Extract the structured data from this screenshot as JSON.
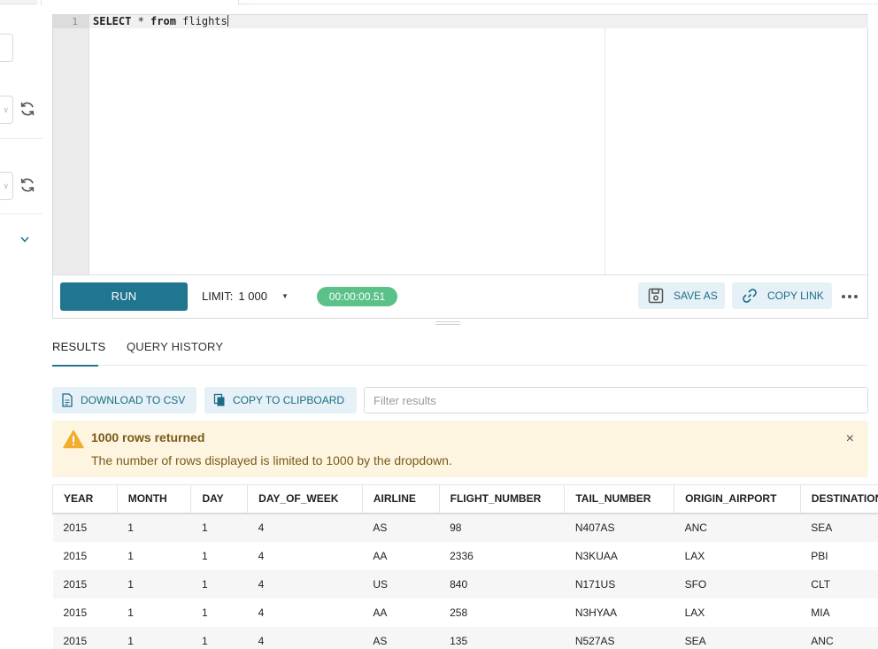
{
  "editor": {
    "line_number": "1",
    "sql_keyword_select": "SELECT",
    "sql_star": " * ",
    "sql_keyword_from": "from",
    "sql_table": " flights"
  },
  "toolbar": {
    "run_label": "RUN",
    "limit_label": "LIMIT:",
    "limit_value": "1 000",
    "timer": "00:00:00.51",
    "save_as_label": "SAVE AS",
    "copy_link_label": "COPY LINK"
  },
  "tabs": {
    "results": "RESULTS",
    "history": "QUERY HISTORY"
  },
  "results_toolbar": {
    "download_csv": "DOWNLOAD TO CSV",
    "copy_clipboard": "COPY TO CLIPBOARD",
    "filter_placeholder": "Filter results"
  },
  "alert": {
    "title": "1000 rows returned",
    "message": "The number of rows displayed is limited to 1000 by the dropdown.",
    "close": "×"
  },
  "table": {
    "columns": [
      "YEAR",
      "MONTH",
      "DAY",
      "DAY_OF_WEEK",
      "AIRLINE",
      "FLIGHT_NUMBER",
      "TAIL_NUMBER",
      "ORIGIN_AIRPORT",
      "DESTINATION_AIRPORT"
    ],
    "rows": [
      [
        "2015",
        "1",
        "1",
        "4",
        "AS",
        "98",
        "N407AS",
        "ANC",
        "SEA"
      ],
      [
        "2015",
        "1",
        "1",
        "4",
        "AA",
        "2336",
        "N3KUAA",
        "LAX",
        "PBI"
      ],
      [
        "2015",
        "1",
        "1",
        "4",
        "US",
        "840",
        "N171US",
        "SFO",
        "CLT"
      ],
      [
        "2015",
        "1",
        "1",
        "4",
        "AA",
        "258",
        "N3HYAA",
        "LAX",
        "MIA"
      ],
      [
        "2015",
        "1",
        "1",
        "4",
        "AS",
        "135",
        "N527AS",
        "SEA",
        "ANC"
      ]
    ]
  },
  "colors": {
    "primary": "#20758f",
    "timer_green": "#5ac189",
    "alert_bg": "#fdf5e0",
    "warning_icon": "#f0ad2e"
  },
  "icons": [
    "refresh-icon",
    "chevron-down-icon",
    "save-icon",
    "link-icon",
    "more-icon",
    "file-icon",
    "copy-icon",
    "warning-icon",
    "close-icon"
  ]
}
